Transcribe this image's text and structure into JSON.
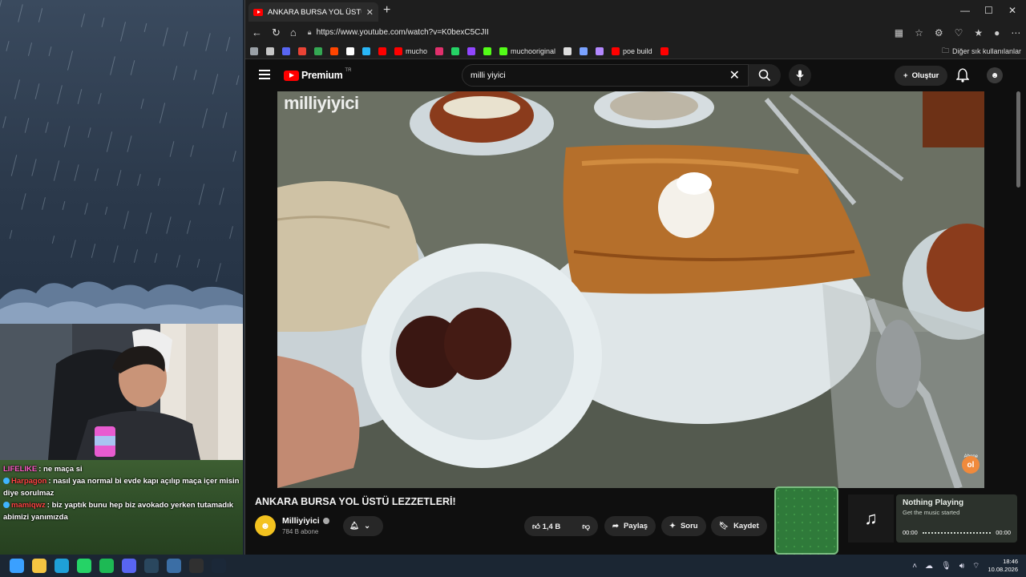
{
  "browser": {
    "tab_title": "ANKARA BURSA YOL ÜSTÜ LEZZETLERİ!",
    "new_tab": "+",
    "url": "https://www.youtube.com/watch?v=K0bexC5CJII",
    "window_controls": [
      "—",
      "☐",
      "✕"
    ],
    "bookmarks": [
      {
        "label": "",
        "color": "#9aa0a6"
      },
      {
        "label": "",
        "color": "#c6c6c6"
      },
      {
        "label": "",
        "color": "#5865f2"
      },
      {
        "label": "",
        "color": "#ea4335"
      },
      {
        "label": "",
        "color": "#34a853"
      },
      {
        "label": "",
        "color": "#ff4500"
      },
      {
        "label": "",
        "color": "#ffffff"
      },
      {
        "label": "",
        "color": "#29b6f6"
      },
      {
        "label": "",
        "color": "#ff0000"
      },
      {
        "label": "mucho",
        "color": "#ff0000"
      },
      {
        "label": "",
        "color": "#e1306c"
      },
      {
        "label": "",
        "color": "#25d366"
      },
      {
        "label": "",
        "color": "#9146ff"
      },
      {
        "label": "",
        "color": "#53fc18"
      },
      {
        "label": "muchooriginal",
        "color": "#53fc18"
      },
      {
        "label": "",
        "color": "#dddddd"
      },
      {
        "label": "",
        "color": "#7aa2ff"
      },
      {
        "label": "",
        "color": "#b388ff"
      },
      {
        "label": "poe build",
        "color": "#ff0000"
      },
      {
        "label": "",
        "color": "#ff0000"
      }
    ],
    "other_bookmarks": "Diğer sık kullanılanlar"
  },
  "youtube": {
    "logo_text": "Premium",
    "region": "TR",
    "search_value": "milli yiyici",
    "create_label": "Oluştur",
    "video_title": "ANKARA BURSA YOL ÜSTÜ LEZZETLERİ!",
    "watermark": "milliyiyici",
    "channel_badge_label": "Abone",
    "channel_badge": "ol",
    "channel_name": "Milliyiyici",
    "subscribers": "784 B abone",
    "likes": "1,4 B",
    "share": "Paylaş",
    "ask": "Soru",
    "save": "Kaydet"
  },
  "chat": [
    {
      "name": "LIFELIKE",
      "text": ": ne maça si",
      "color": "#ff5cc8"
    },
    {
      "name": "Harpagon",
      "text": ": nasıl yaa normal bi evde kapı açılıp maça içer misin diye sorulmaz",
      "color": "#ff4444"
    },
    {
      "name": "mamiqwz",
      "text": ": biz yaptık bunu hep biz avokado yerken tutamadık abimizi yanımızda",
      "color": "#ff4444"
    }
  ],
  "music": {
    "title": "Nothing Playing",
    "subtitle": "Get the music started",
    "time_start": "00:00",
    "time_end": "00:00"
  },
  "taskbar": {
    "icons": [
      {
        "name": "windows-start-icon",
        "color": "#3aa0ff"
      },
      {
        "name": "file-explorer-icon",
        "color": "#f4c542"
      },
      {
        "name": "edge-icon",
        "color": "#1fa0d8"
      },
      {
        "name": "whatsapp-icon",
        "color": "#25d366"
      },
      {
        "name": "spotify-icon",
        "color": "#1db954"
      },
      {
        "name": "discord-icon",
        "color": "#5865f2"
      },
      {
        "name": "steam-icon",
        "color": "#2a475e"
      },
      {
        "name": "app-icon",
        "color": "#3b6ea5"
      },
      {
        "name": "obs-icon",
        "color": "#303030"
      },
      {
        "name": "steam-icon-2",
        "color": "#1b2838"
      }
    ],
    "time": "18:46",
    "date": "10.08.2026"
  }
}
